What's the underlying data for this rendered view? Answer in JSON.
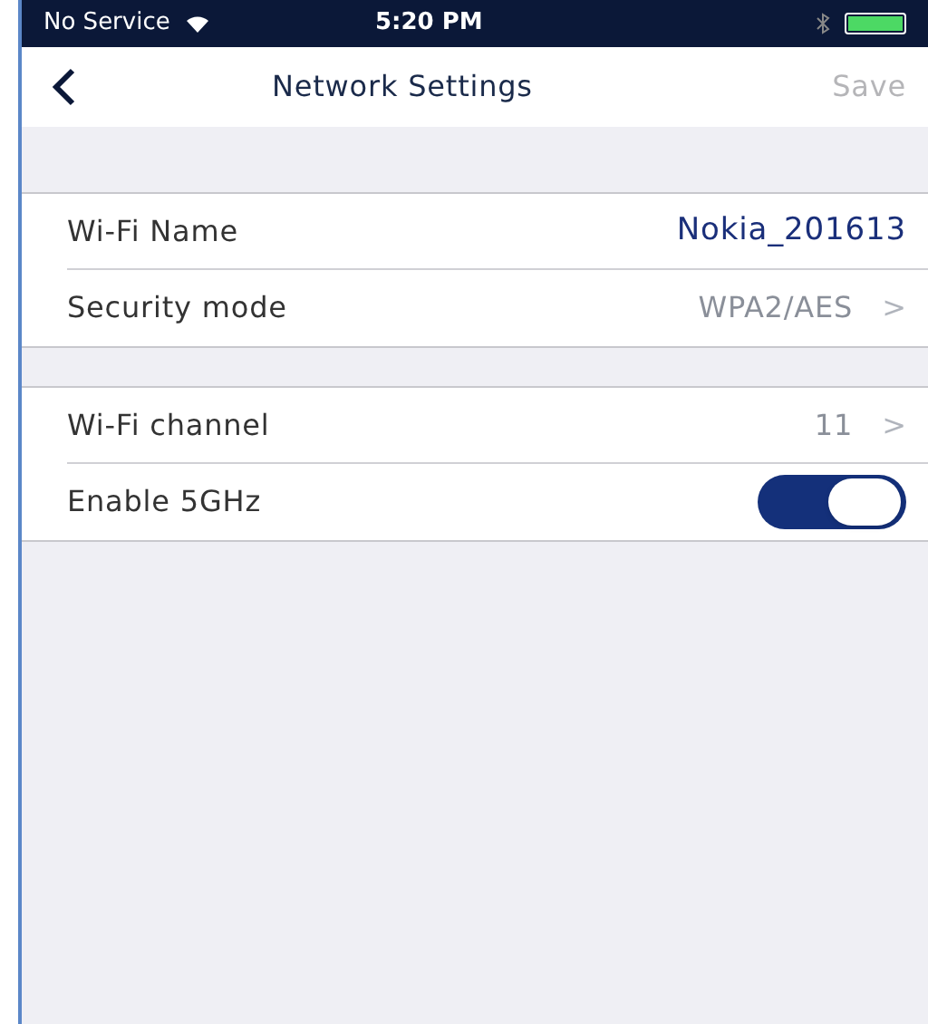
{
  "status_bar": {
    "carrier": "No Service",
    "time": "5:20 PM"
  },
  "nav": {
    "title": "Network Settings",
    "save": "Save",
    "save_disabled": true
  },
  "sections": [
    {
      "rows": [
        {
          "kind": "value",
          "label": "Wi-Fi Name",
          "value": "Nokia_201613"
        },
        {
          "kind": "link",
          "label": "Security mode",
          "value": "WPA2/AES",
          "chevron": ">"
        }
      ]
    },
    {
      "rows": [
        {
          "kind": "link",
          "label": "Wi-Fi channel",
          "value": "11",
          "chevron": ">"
        },
        {
          "kind": "toggle",
          "label": "Enable 5GHz",
          "on": true
        }
      ]
    }
  ]
}
